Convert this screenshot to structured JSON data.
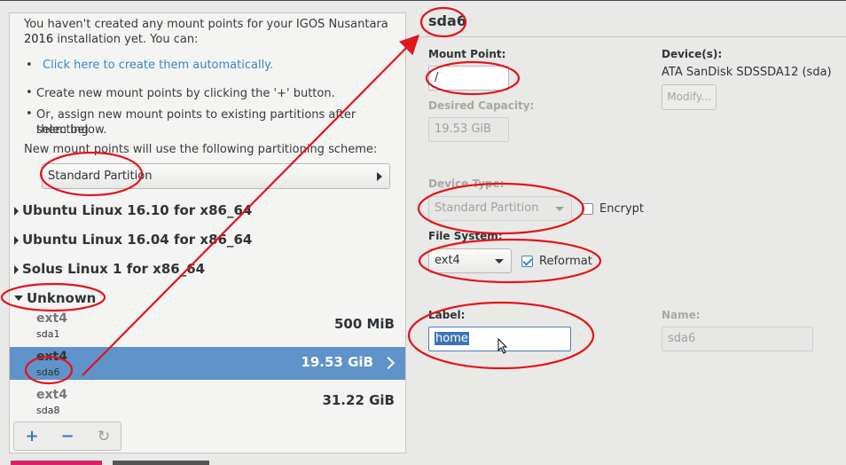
{
  "left": {
    "intro": [
      "You haven't created any mount points for your IGOS Nusantara 2016",
      "2016 installation yet.  You can:"
    ],
    "auto_link": "Click here to create them automatically.",
    "bullets": [
      "Create new mount points by clicking the '+' button.",
      "Or, assign new mount points to existing partitions after selecting",
      "them below."
    ],
    "scheme_note": "New mount points will use the following partitioning scheme:",
    "scheme_value": "Standard Partition",
    "groups": [
      {
        "label": "Ubuntu Linux 16.10 for x86_64"
      },
      {
        "label": "Ubuntu Linux 16.04 for x86_64"
      },
      {
        "label": "Solus Linux 1 for x86_64"
      },
      {
        "label": "Unknown"
      }
    ],
    "partitions": [
      {
        "fs": "ext4",
        "dev": "sda1",
        "size": "500 MiB"
      },
      {
        "fs": "ext4",
        "dev": "sda6",
        "size": "19.53 GiB"
      },
      {
        "fs": "ext4",
        "dev": "sda8",
        "size": "31.22 GiB"
      }
    ],
    "toolbar": {
      "add": "+",
      "remove": "−",
      "refresh": "↻"
    }
  },
  "right": {
    "title": "sda6",
    "mount_point_label": "Mount Point:",
    "mount_point_value": "/",
    "devices_label": "Device(s):",
    "devices_value": "ATA SanDisk SDSSDA12 (sda)",
    "modify_label": "Modify...",
    "capacity_label": "Desired Capacity:",
    "capacity_value": "19.53 GiB",
    "device_type_label": "Device Type:",
    "device_type_value": "Standard Partition",
    "encrypt_label": "Encrypt",
    "fs_label": "File System:",
    "fs_value": "ext4",
    "reformat_label": "Reformat",
    "label_label": "Label:",
    "label_value": "home",
    "name_label": "Name:",
    "name_value": "sda6"
  },
  "colors": {
    "accent": "#5f93c9",
    "annotation": "#e0161b",
    "link": "#3a86c8"
  },
  "icons": {
    "add": "plus-icon",
    "remove": "minus-icon",
    "refresh": "refresh-icon",
    "expand": "chevron-right-icon"
  }
}
